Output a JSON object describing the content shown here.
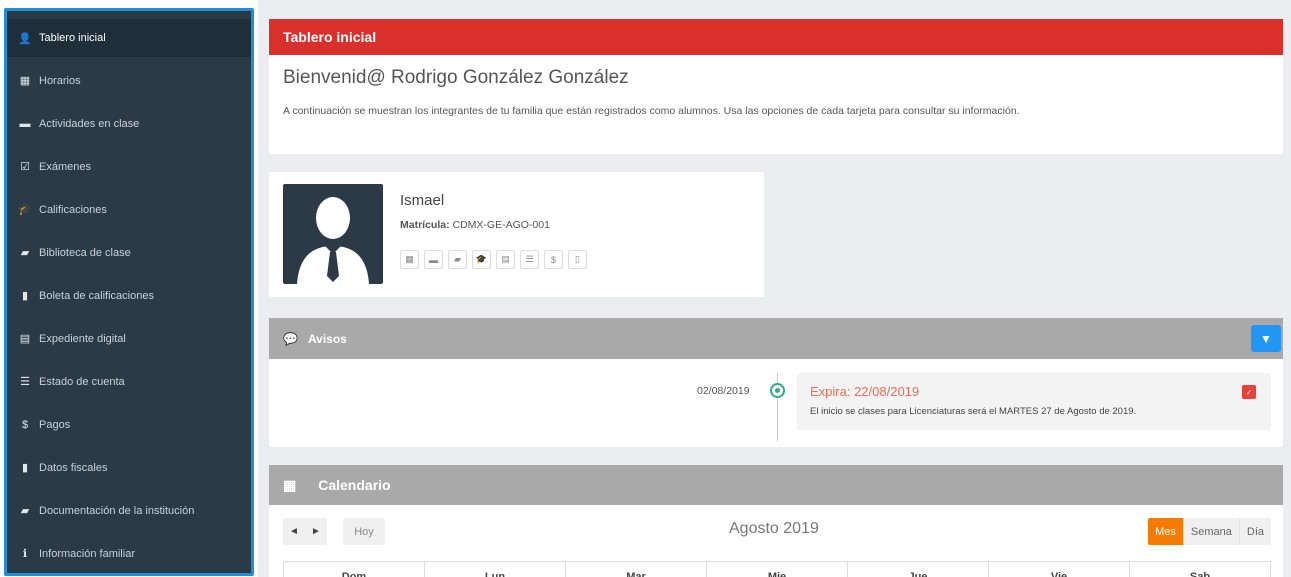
{
  "sidebar": {
    "items": [
      {
        "label": "Tablero inicial",
        "icon": "user-icon",
        "glyph": "👤"
      },
      {
        "label": "Horarios",
        "icon": "calendar-icon",
        "glyph": "▦"
      },
      {
        "label": "Actividades en clase",
        "icon": "briefcase-icon",
        "glyph": "▬"
      },
      {
        "label": "Exámenes",
        "icon": "checkbox-icon",
        "glyph": "☑"
      },
      {
        "label": "Calificaciones",
        "icon": "graduation-cap-icon",
        "glyph": "🎓"
      },
      {
        "label": "Biblioteca de clase",
        "icon": "folder-open-icon",
        "glyph": "▰"
      },
      {
        "label": "Boleta de calificaciones",
        "icon": "file-icon",
        "glyph": "▮"
      },
      {
        "label": "Expediente digital",
        "icon": "archive-icon",
        "glyph": "▤"
      },
      {
        "label": "Estado de cuenta",
        "icon": "list-icon",
        "glyph": "☰"
      },
      {
        "label": "Pagos",
        "icon": "dollar-icon",
        "glyph": "$"
      },
      {
        "label": "Datos fiscales",
        "icon": "bookmark-icon",
        "glyph": "▮"
      },
      {
        "label": "Documentación de la institución",
        "icon": "book-icon",
        "glyph": "▰"
      },
      {
        "label": "Información familiar",
        "icon": "info-icon",
        "glyph": "ℹ"
      }
    ]
  },
  "header": {
    "title": "Tablero inicial",
    "welcome": "Bienvenid@ Rodrigo González González",
    "description": "A continuación se muestran los integrantes de tu familia que están registrados como alumnos. Usa las opciones de cada tarjeta para consultar su información."
  },
  "student": {
    "name": "Ismael",
    "matricula_label": "Matrícula:",
    "matricula": "CDMX-GE-AGO-001",
    "actions": [
      {
        "icon": "calendar-icon",
        "glyph": "▦"
      },
      {
        "icon": "briefcase-icon",
        "glyph": "▬"
      },
      {
        "icon": "folder-open-icon",
        "glyph": "▰"
      },
      {
        "icon": "graduation-cap-icon",
        "glyph": "🎓"
      },
      {
        "icon": "archive-icon",
        "glyph": "▤"
      },
      {
        "icon": "list-icon",
        "glyph": "☰"
      },
      {
        "icon": "dollar-icon",
        "glyph": "$"
      },
      {
        "icon": "file-text-icon",
        "glyph": "▯"
      }
    ]
  },
  "avisos": {
    "title": "Avisos",
    "date": "02/08/2019",
    "expira": "Expira: 22/08/2019",
    "text": "El inicio se clases para Licenciaturas será el MARTES 27 de Agosto de 2019."
  },
  "calendar": {
    "title": "Calendario",
    "month": "Agosto 2019",
    "prev": "◄",
    "next": "►",
    "today": "Hoy",
    "views": [
      "Mes",
      "Semana",
      "Día"
    ],
    "days": [
      "Dom",
      "Lun",
      "Mar",
      "Mie",
      "Jue",
      "Vie",
      "Sab"
    ]
  },
  "colors": {
    "sidebar_bg": "#2a3a47",
    "sidebar_border": "#1d8ed8",
    "header_red": "#d9302c",
    "panel_gray": "#a9a9a9",
    "accent_orange": "#f57c00",
    "accent_blue": "#2196f3",
    "timeline_green": "#2ea88f"
  }
}
